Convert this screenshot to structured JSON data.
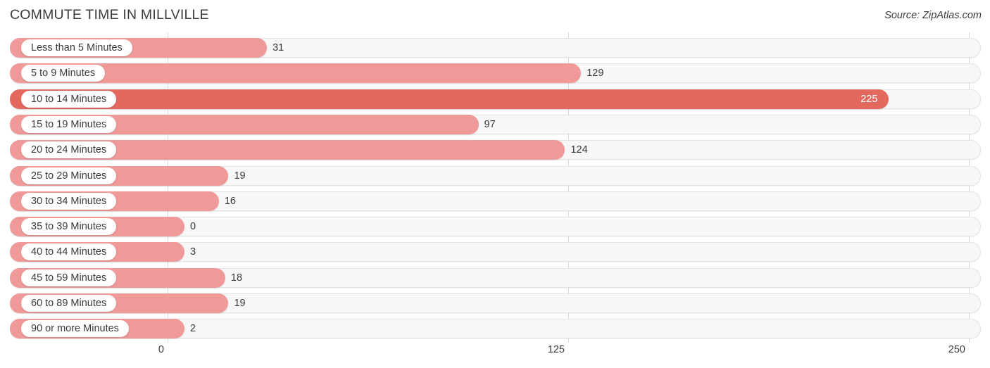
{
  "header": {
    "title": "COMMUTE TIME IN MILLVILLE",
    "source": "Source: ZipAtlas.com"
  },
  "colors": {
    "bar": "#ef9a98",
    "bar_highlight": "#e3695f",
    "track": "#f7f7f7",
    "track_border": "#e3e3e3",
    "gridline": "#d8d8d8",
    "text": "#3a3a3a",
    "value_inside": "#ffffff"
  },
  "chart_data": {
    "type": "bar",
    "orientation": "horizontal",
    "title": "COMMUTE TIME IN MILLVILLE",
    "subtitle": "",
    "xlabel": "",
    "ylabel": "",
    "source": "Source: ZipAtlas.com",
    "xlim": [
      0,
      250
    ],
    "xticks": [
      0,
      125,
      250
    ],
    "xtick_labels": [
      "0",
      "125",
      "250"
    ],
    "grid": true,
    "legend": false,
    "categories": [
      "Less than 5 Minutes",
      "5 to 9 Minutes",
      "10 to 14 Minutes",
      "15 to 19 Minutes",
      "20 to 24 Minutes",
      "25 to 29 Minutes",
      "30 to 34 Minutes",
      "35 to 39 Minutes",
      "40 to 44 Minutes",
      "45 to 59 Minutes",
      "60 to 89 Minutes",
      "90 or more Minutes"
    ],
    "values": [
      31,
      129,
      225,
      97,
      124,
      19,
      16,
      0,
      3,
      18,
      19,
      2
    ],
    "value_labels": [
      "31",
      "129",
      "225",
      "97",
      "124",
      "19",
      "16",
      "0",
      "3",
      "18",
      "19",
      "2"
    ],
    "max_value": 225,
    "highlight_index": 2
  }
}
